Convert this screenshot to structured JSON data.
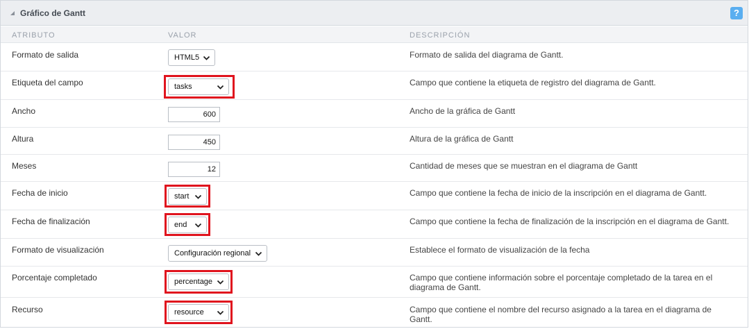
{
  "panel": {
    "title": "Gráfico de Gantt",
    "help_label": "?"
  },
  "columns": {
    "attr": "ATRIBUTO",
    "value": "VALOR",
    "desc": "DESCRIPCIÓN"
  },
  "rows": [
    {
      "label": "Formato de salida",
      "value": "HTML5",
      "desc": "Formato de salida del diagrama de Gantt."
    },
    {
      "label": "Etiqueta del campo",
      "value": "tasks",
      "desc": "Campo que contiene la etiqueta de registro del diagrama de Gantt."
    },
    {
      "label": "Ancho",
      "value": "600",
      "desc": "Ancho de la gráfica de Gantt"
    },
    {
      "label": "Altura",
      "value": "450",
      "desc": "Altura de la gráfica de Gantt"
    },
    {
      "label": "Meses",
      "value": "12",
      "desc": "Cantidad de meses que se muestran en el diagrama de Gantt"
    },
    {
      "label": "Fecha de inicio",
      "value": "start",
      "desc": "Campo que contiene la fecha de inicio de la inscripción en el diagrama de Gantt."
    },
    {
      "label": "Fecha de finalización",
      "value": "end",
      "desc": "Campo que contiene la fecha de finalización de la inscripción en el diagrama de Gantt."
    },
    {
      "label": "Formato de visualización",
      "value": "Configuración regional",
      "desc": "Establece el formato de visualización de la fecha"
    },
    {
      "label": "Porcentaje completado",
      "value": "percentage",
      "desc": "Campo que contiene información sobre el porcentaje completado de la tarea en el diagrama de Gantt."
    },
    {
      "label": "Recurso",
      "value": "resource",
      "desc": "Campo que contiene el nombre del recurso asignado a la tarea en el diagrama de Gantt."
    }
  ],
  "colors": {
    "highlight": "#e0141e",
    "help_button": "#5aaef0",
    "header_bg": "#eceef1"
  },
  "icons": {
    "collapse": "caret-icon",
    "help": "help-icon",
    "dropdown": "chevron-down-icon"
  }
}
